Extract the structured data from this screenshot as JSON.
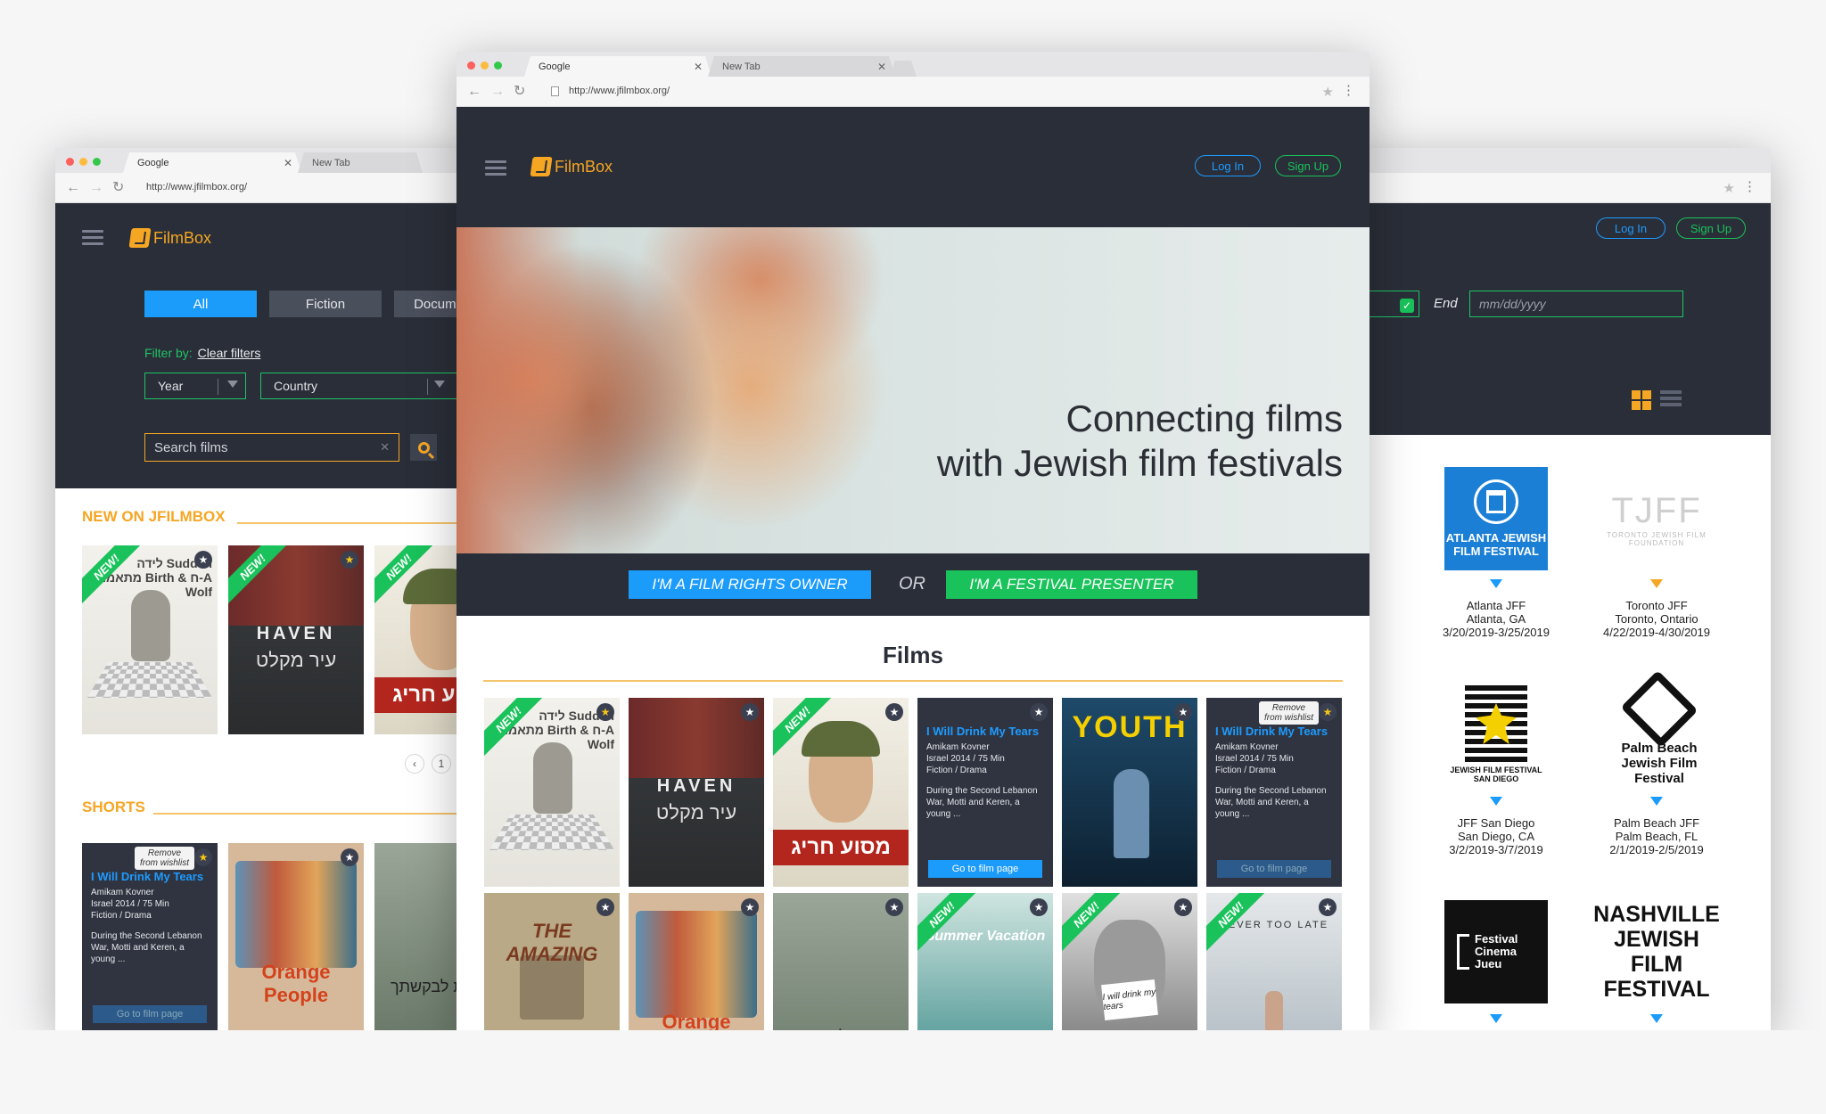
{
  "browser": {
    "tab_active": "Google",
    "tab_inactive": "New Tab",
    "url": "http://www.jfilmbox.org/"
  },
  "brand": {
    "name": "FilmBox",
    "accent": "#f5a623",
    "blue": "#1b9bfa",
    "green": "#19c25a",
    "dark": "#2a2e38"
  },
  "auth": {
    "login": "Log In",
    "signup": "Sign Up"
  },
  "left": {
    "filters": [
      "All",
      "Fiction",
      "Docume"
    ],
    "filter_by": "Filter by:",
    "clear": "Clear filters",
    "year": "Year",
    "country": "Country",
    "search_placeholder": "Search films",
    "new_section": "NEW ON JFILMBOX",
    "shorts_section": "SHORTS",
    "page": "1",
    "card": {
      "tooltip_line1": "Remove",
      "tooltip_line2": "from wishlist",
      "title": "I Will Drink My Tears",
      "meta1": "Amikam Kovner",
      "meta2": "Israel 2014 / 75 Min",
      "meta3": "Fiction / Drama",
      "desc": "During the Second Lebanon War, Motti and Keren, a young ...",
      "cta": "Go to film page"
    }
  },
  "hero": {
    "line1": "Connecting films",
    "line2": "with Jewish film festivals",
    "cta_owner": "I'm a film rights owner",
    "or": "OR",
    "cta_presenter": "I'm a festival presenter"
  },
  "films": {
    "heading": "Films",
    "new_label": "NEW!",
    "posters": {
      "sudden": "לידה Sudden מתאמחת Birth & ח-A Wolf",
      "haven": "HAVEN",
      "haven_heb": "עיר מקלט",
      "masa": "מסוע חריג",
      "youth": "YOUTH",
      "amazing": "THE AMAZING",
      "orange": "Orange People",
      "tochnit": "תכנית לבקשתך",
      "summer": "Summer Vacation",
      "drink_sign": "I will drink my tears",
      "never": "NEVER TOO LATE"
    }
  },
  "right": {
    "end_label": "End",
    "end_placeholder": "mm/dd/yyyy",
    "festivals": [
      {
        "logo": "ATLANTA JEWISH FILM FESTIVAL",
        "name": "Atlanta JFF",
        "place": "Atlanta, GA",
        "dates": "3/20/2019-3/25/2019"
      },
      {
        "logo": "TJFF",
        "logo_sub": "TORONTO JEWISH FILM FOUNDATION",
        "name": "Toronto JFF",
        "place": "Toronto, Ontario",
        "dates": "4/22/2019-4/30/2019"
      },
      {
        "logo": "JEWISH FILM FESTIVAL SAN DIEGO",
        "name": "JFF San Diego",
        "place": "San Diego, CA",
        "dates": "3/2/2019-3/7/2019"
      },
      {
        "logo": "Palm Beach Jewish Film Festival",
        "name": "Palm Beach JFF",
        "place": "Palm Beach, FL",
        "dates": "2/1/2019-2/5/2019"
      },
      {
        "logo": "Festival Cinema Jueu",
        "name": "",
        "place": "",
        "dates": ""
      },
      {
        "logo": "NASHVILLE JEWISH FILM FESTIVAL",
        "name": "",
        "place": "",
        "dates": ""
      }
    ]
  }
}
